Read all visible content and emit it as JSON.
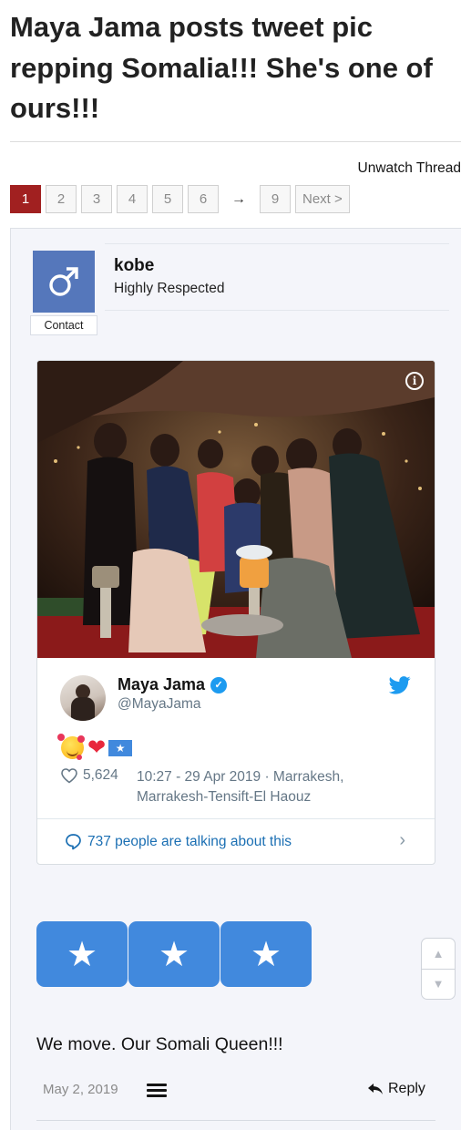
{
  "thread": {
    "title": "Maya Jama posts tweet pic repping Somalia!!! She's one of ours!!!",
    "unwatch_label": "Unwatch Thread"
  },
  "pagination": {
    "pages": [
      "1",
      "2",
      "3",
      "4",
      "5",
      "6"
    ],
    "current": "1",
    "arrow": "→",
    "last": "9",
    "next_label": "Next >"
  },
  "post": {
    "author": {
      "name": "kobe",
      "title": "Highly Respected",
      "avatar_icon": "male-symbol-icon",
      "avatar_color": "#5577bb",
      "contact_label": "Contact"
    },
    "tweet": {
      "info_icon": "i",
      "name": "Maya Jama",
      "verified_icon": "✓",
      "handle": "@MayaJama",
      "flag_star": "★",
      "heart": "❤",
      "likes": "5,624",
      "meta": "10:27 - 29 Apr 2019 · Marrakesh, Marrakesh-Tensift-El Haouz",
      "talking": "737 people are talking about this",
      "chevron": "›",
      "brand_color": "#1d9bf0"
    },
    "stars": [
      "★",
      "★",
      "★"
    ],
    "scroll_up": "▲",
    "scroll_down": "▼",
    "message": "We move. Our Somali Queen!!!",
    "date": "May 2, 2019",
    "reply_label": "Reply",
    "accent": "#a12020",
    "flag_color": "#4189dd"
  }
}
